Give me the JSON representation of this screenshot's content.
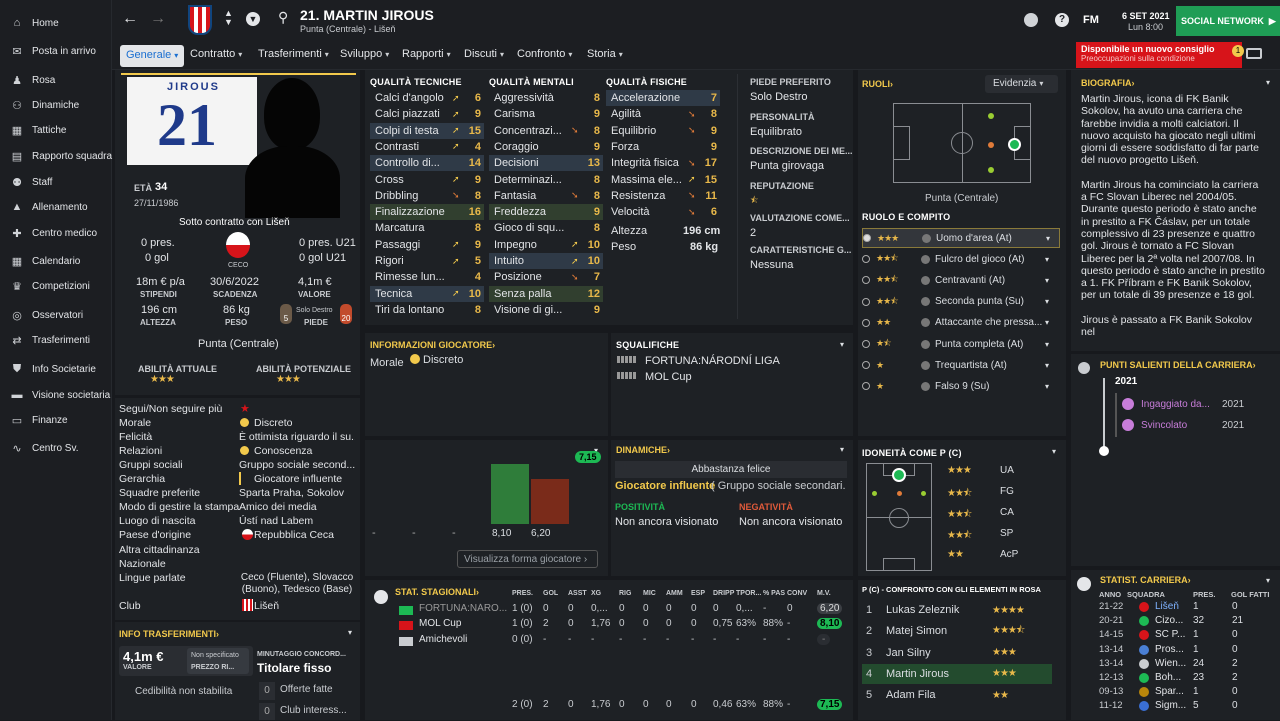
{
  "sidebar": {
    "items": [
      {
        "label": "Home",
        "icon": "home-icon",
        "glyph": "⌂"
      },
      {
        "label": "Posta in arrivo",
        "icon": "inbox-icon",
        "glyph": "✉"
      },
      {
        "label": "Rosa",
        "icon": "squad-icon",
        "glyph": "♟"
      },
      {
        "label": "Dinamiche",
        "icon": "dynamics-icon",
        "glyph": "⚇"
      },
      {
        "label": "Tattiche",
        "icon": "tactics-icon",
        "glyph": "▦"
      },
      {
        "label": "Rapporto squadra",
        "icon": "report-icon",
        "glyph": "▤"
      },
      {
        "label": "Staff",
        "icon": "staff-icon",
        "glyph": "⚉"
      },
      {
        "label": "Allenamento",
        "icon": "training-icon",
        "glyph": "▲"
      },
      {
        "label": "Centro medico",
        "icon": "medical-icon",
        "glyph": "✚"
      },
      {
        "label": "Calendario",
        "icon": "calendar-icon",
        "glyph": "▦"
      },
      {
        "label": "Competizioni",
        "icon": "trophy-icon",
        "glyph": "♛"
      },
      {
        "label": "Osservatori",
        "icon": "scout-icon",
        "glyph": "◎"
      },
      {
        "label": "Trasferimenti",
        "icon": "transfer-icon",
        "glyph": "⇄"
      },
      {
        "label": "Info Societarie",
        "icon": "club-info-icon",
        "glyph": "⛊"
      },
      {
        "label": "Visione societaria",
        "icon": "vision-icon",
        "glyph": "▬"
      },
      {
        "label": "Finanze",
        "icon": "finance-icon",
        "glyph": "▭"
      },
      {
        "label": "Centro Sv.",
        "icon": "dev-centre-icon",
        "glyph": "∿"
      }
    ]
  },
  "header": {
    "title": "21. MARTIN JIROUS",
    "subtitle": "Punta (Centrale) - Lišeň",
    "date": "6 SET 2021",
    "time": "Lun 8:00",
    "social": "SOCIAL NETWORK",
    "fm": "FM",
    "help": "?"
  },
  "tabs": [
    "Generale",
    "Contratto",
    "Trasferimenti",
    "Sviluppo",
    "Rapporti",
    "Discuti",
    "Confronto",
    "Storia"
  ],
  "notice": {
    "title": "Disponibile un nuovo consiglio",
    "sub": "Preoccupazioni sulla condizione",
    "count": "1"
  },
  "profile": {
    "shirt_name": "JIROUS",
    "shirt_number": "21",
    "age_label": "ETÀ",
    "age": "34",
    "dob": "27/11/1986",
    "contract": "Sotto contratto con Lišeň",
    "apps": "0 pres.",
    "goals": "0 gol",
    "u21_apps": "0 pres. U21",
    "u21_goals": "0 gol U21",
    "nation": "CECO",
    "wage": "18m € p/a",
    "wage_label": "STIPENDI",
    "expiry": "30/6/2022",
    "expiry_label": "SCADENZA",
    "value": "4,1m €",
    "value_label": "VALORE",
    "height": "196 cm",
    "height_label": "ALTEZZA",
    "weight": "86 kg",
    "weight_label": "PESO",
    "foot_left": "5",
    "foot_right": "20",
    "foot_text": "Solo Destro",
    "foot_label": "PIEDE",
    "position": "Punta (Centrale)",
    "ca_label": "ABILITÀ ATTUALE",
    "pa_label": "ABILITÀ POTENZIALE"
  },
  "details": [
    {
      "k": "Segui/Non seguire più",
      "v": ""
    },
    {
      "k": "Morale",
      "v": "Discreto"
    },
    {
      "k": "Felicità",
      "v": "È ottimista riguardo il su..."
    },
    {
      "k": "Relazioni",
      "v": "Conoscenza"
    },
    {
      "k": "Gruppi sociali",
      "v": "Gruppo sociale second..."
    },
    {
      "k": "Gerarchia",
      "v": "Giocatore influente"
    },
    {
      "k": "Squadre preferite",
      "v": "Sparta Praha, Sokolov"
    },
    {
      "k": "Modo di gestire la stampa",
      "v": "Amico dei media"
    },
    {
      "k": "Luogo di nascita",
      "v": "Ústí nad Labem"
    },
    {
      "k": "Paese d'origine",
      "v": "Repubblica Ceca"
    },
    {
      "k": "Altra cittadinanza",
      "v": ""
    },
    {
      "k": "Nazionale",
      "v": ""
    },
    {
      "k": "Lingue parlate",
      "v": "Ceco (Fluente), Slovacco (Buono), Tedesco (Base)"
    },
    {
      "k": "Club",
      "v": "Lišeň"
    }
  ],
  "transfer": {
    "title": "INFO TRASFERIMENTI",
    "value": "4,1m €",
    "value_label": "VALORE",
    "asking": "Non specificato",
    "asking_label": "PREZZO RI...",
    "status": "Cedibilità non stabilita",
    "playing_time_label": "MINUTAGGIO CONCORD...",
    "playing_time": "Titolare fisso",
    "offers": "Offerte fatte",
    "offers_n": "0",
    "interest": "Club interess...",
    "interest_n": "0"
  },
  "attributes": {
    "technical_title": "QUALITÀ TECNICHE",
    "mental_title": "QUALITÀ MENTALI",
    "physical_title": "QUALITÀ FISICHE",
    "technical": [
      {
        "n": "Calci d'angolo",
        "v": "6",
        "a": "up",
        "h": ""
      },
      {
        "n": "Calci piazzati",
        "v": "9",
        "a": "up",
        "h": ""
      },
      {
        "n": "Colpi di testa",
        "v": "15",
        "a": "up",
        "h": "b"
      },
      {
        "n": "Contrasti",
        "v": "4",
        "a": "up",
        "h": ""
      },
      {
        "n": "Controllo di...",
        "v": "14",
        "a": "",
        "h": "b"
      },
      {
        "n": "Cross",
        "v": "9",
        "a": "up",
        "h": ""
      },
      {
        "n": "Dribbling",
        "v": "8",
        "a": "down",
        "h": ""
      },
      {
        "n": "Finalizzazione",
        "v": "16",
        "a": "",
        "h": "g"
      },
      {
        "n": "Marcatura",
        "v": "8",
        "a": "",
        "h": ""
      },
      {
        "n": "Passaggi",
        "v": "9",
        "a": "up",
        "h": ""
      },
      {
        "n": "Rigori",
        "v": "5",
        "a": "up",
        "h": ""
      },
      {
        "n": "Rimesse lun...",
        "v": "4",
        "a": "",
        "h": ""
      },
      {
        "n": "Tecnica",
        "v": "10",
        "a": "up",
        "h": "b"
      },
      {
        "n": "Tiri da lontano",
        "v": "8",
        "a": "",
        "h": ""
      }
    ],
    "mental": [
      {
        "n": "Aggressività",
        "v": "8",
        "a": "",
        "h": ""
      },
      {
        "n": "Carisma",
        "v": "9",
        "a": "",
        "h": ""
      },
      {
        "n": "Concentrazi...",
        "v": "8",
        "a": "down",
        "h": ""
      },
      {
        "n": "Coraggio",
        "v": "9",
        "a": "",
        "h": ""
      },
      {
        "n": "Decisioni",
        "v": "13",
        "a": "",
        "h": "b"
      },
      {
        "n": "Determinazi...",
        "v": "8",
        "a": "",
        "h": ""
      },
      {
        "n": "Fantasia",
        "v": "8",
        "a": "down",
        "h": ""
      },
      {
        "n": "Freddezza",
        "v": "9",
        "a": "",
        "h": "g"
      },
      {
        "n": "Gioco di squ...",
        "v": "8",
        "a": "",
        "h": ""
      },
      {
        "n": "Impegno",
        "v": "10",
        "a": "up",
        "h": ""
      },
      {
        "n": "Intuito",
        "v": "10",
        "a": "up",
        "h": "b"
      },
      {
        "n": "Posizione",
        "v": "7",
        "a": "down",
        "h": ""
      },
      {
        "n": "Senza palla",
        "v": "12",
        "a": "",
        "h": "g"
      },
      {
        "n": "Visione di gi...",
        "v": "9",
        "a": "",
        "h": ""
      }
    ],
    "physical": [
      {
        "n": "Accelerazione",
        "v": "7",
        "a": "",
        "h": "b"
      },
      {
        "n": "Agilità",
        "v": "8",
        "a": "down",
        "h": ""
      },
      {
        "n": "Equilibrio",
        "v": "9",
        "a": "down",
        "h": ""
      },
      {
        "n": "Forza",
        "v": "9",
        "a": "",
        "h": ""
      },
      {
        "n": "Integrità fisica",
        "v": "17",
        "a": "down",
        "h": ""
      },
      {
        "n": "Massima ele...",
        "v": "15",
        "a": "up",
        "h": ""
      },
      {
        "n": "Resistenza",
        "v": "11",
        "a": "down",
        "h": ""
      },
      {
        "n": "Velocità",
        "v": "6",
        "a": "down",
        "h": ""
      }
    ],
    "height_label": "Altezza",
    "height": "196 cm",
    "weight_label": "Peso",
    "weight": "86 kg"
  },
  "side_info": [
    {
      "k": "PIEDE PREFERITO",
      "v": "Solo Destro"
    },
    {
      "k": "PERSONALITÀ",
      "v": "Equilibrato"
    },
    {
      "k": "DESCRIZIONE DEI ME...",
      "v": "Punta girovaga"
    },
    {
      "k": "REPUTAZIONE",
      "v": ""
    },
    {
      "k": "VALUTAZIONE COME...",
      "v": "2"
    },
    {
      "k": "CARATTERISTICHE G...",
      "v": "Nessuna"
    }
  ],
  "roles": {
    "title": "RUOLI",
    "evidence": "Evidenzia",
    "position": "Punta (Centrale)",
    "role_title": "RUOLO E COMPITO",
    "list": [
      {
        "n": "Uomo d'area (At)",
        "s": "3"
      },
      {
        "n": "Fulcro del gioco (At)",
        "s": "2.5"
      },
      {
        "n": "Centravanti (At)",
        "s": "2.5"
      },
      {
        "n": "Seconda punta (Su)",
        "s": "2.5"
      },
      {
        "n": "Attaccante che pressa...",
        "s": "2"
      },
      {
        "n": "Punta completa (At)",
        "s": "1.5"
      },
      {
        "n": "Trequartista (At)",
        "s": "1"
      },
      {
        "n": "Falso 9 (Su)",
        "s": "1"
      }
    ]
  },
  "player_info": {
    "title": "INFORMAZIONI GIOCATORE",
    "morale_label": "Morale",
    "morale": "Discreto"
  },
  "suspensions": {
    "title": "SQUALIFICHE",
    "items": [
      "FORTUNA:NÁRODNÍ LIGA",
      "MOL Cup"
    ]
  },
  "form": {
    "badge": "7,15",
    "bars": [
      {
        "label": "8,10"
      },
      {
        "label": "6,20"
      }
    ],
    "empty": [
      "-",
      "-",
      "-"
    ],
    "link": "Visualizza forma giocatore"
  },
  "dynamics": {
    "title": "DINAMICHE",
    "happiness": "Abbastanza felice",
    "status": "Giocatore influente",
    "group": "( Gruppo sociale secondari...",
    "pos_label": "POSITIVITÀ",
    "pos": "Non ancora visionato",
    "neg_label": "NEGATIVITÀ",
    "neg": "Non ancora visionato"
  },
  "suitability": {
    "title": "IDONEITÀ COME P (C)",
    "rows": [
      {
        "p": "UA",
        "s": "3"
      },
      {
        "p": "FG",
        "s": "2.5"
      },
      {
        "p": "CA",
        "s": "2.5"
      },
      {
        "p": "SP",
        "s": "2.5"
      },
      {
        "p": "AcP",
        "s": "2"
      }
    ]
  },
  "season_stats": {
    "title": "STAT. STAGIONALI",
    "cols": [
      "PRES.",
      "GOL",
      "ASST",
      "XG",
      "RIG",
      "MIC",
      "AMM",
      "ESP",
      "DRIPP",
      "TPOR...",
      "% PAS",
      "CONV",
      "M.V."
    ],
    "rows": [
      {
        "c": "FORTUNA:NÁRO...",
        "v": [
          "1 (0)",
          "0",
          "0",
          "0,...",
          "0",
          "0",
          "0",
          "0",
          "0",
          "0,...",
          "-",
          "0",
          "6,20"
        ]
      },
      {
        "c": "MOL Cup",
        "v": [
          "1 (0)",
          "2",
          "0",
          "1,76",
          "0",
          "0",
          "0",
          "0",
          "0,75",
          "63%",
          "88%",
          "-",
          "8,10"
        ]
      },
      {
        "c": "Amichevoli",
        "v": [
          "0 (0)",
          "-",
          "-",
          "-",
          "-",
          "-",
          "-",
          "-",
          "-",
          "-",
          "-",
          "-",
          "-"
        ]
      }
    ],
    "total": [
      "2 (0)",
      "2",
      "0",
      "1,76",
      "0",
      "0",
      "0",
      "0",
      "0,46",
      "63%",
      "88%",
      "-",
      "7,15"
    ]
  },
  "comparison": {
    "title": "P (C) - CONFRONTO CON GLI ELEMENTI IN ROSA",
    "rows": [
      {
        "n": "1",
        "nm": "Lukas Zeleznik",
        "s": "4"
      },
      {
        "n": "2",
        "nm": "Matej Simon",
        "s": "3.5"
      },
      {
        "n": "3",
        "nm": "Jan Silny",
        "s": "3"
      },
      {
        "n": "4",
        "nm": "Martin Jirous",
        "s": "3"
      },
      {
        "n": "5",
        "nm": "Adam Fila",
        "s": "2"
      }
    ]
  },
  "bio": {
    "title": "BIOGRAFIA",
    "p1": "Martin Jirous, icona di FK Banik Sokolov, ha avuto una carriera che farebbe invidia a molti calciatori. Il nuovo acquisto ha giocato negli ultimi giorni di essere soddisfatto di far parte del nuovo progetto Lišeň.",
    "p2": "Martin Jirous ha cominciato la carriera a FC Slovan Liberec nel 2004/05. Durante questo periodo è stato anche in prestito a FK Čáslav, per un totale complessivo di 23 presenze e quattro gol. Jirous è tornato a FC Slovan Liberec per la 2ª volta nel 2007/08. In questo periodo è stato anche in prestito a 1. FK Příbram e FK Banik Sokolov, per un totale di 39 presenze e 18 gol.",
    "p3": "Jirous è passato a FK Banik Sokolov nel"
  },
  "highlights": {
    "title": "PUNTI SALIENTI DELLA CARRIERA",
    "year": "2021",
    "items": [
      {
        "t": "Ingaggiato da...",
        "y": "2021"
      },
      {
        "t": "Svincolato",
        "y": "2021"
      }
    ]
  },
  "career": {
    "title": "STATIST. CARRIERA",
    "cols": [
      "ANNO",
      "SQUADRA",
      "PRES.",
      "GOL FATTI"
    ],
    "rows": [
      {
        "y": "21-22",
        "t": "Lišeň",
        "a": "1",
        "g": "0"
      },
      {
        "y": "20-21",
        "t": "Cizo...",
        "a": "32",
        "g": "21"
      },
      {
        "y": "14-15",
        "t": "SC P...",
        "a": "1",
        "g": "0"
      },
      {
        "y": "13-14",
        "t": "Pros...",
        "a": "1",
        "g": "0"
      },
      {
        "y": "13-14",
        "t": "Wien...",
        "a": "24",
        "g": "2"
      },
      {
        "y": "12-13",
        "t": "Boh...",
        "a": "23",
        "g": "2"
      },
      {
        "y": "09-13",
        "t": "Spar...",
        "a": "1",
        "g": "0"
      },
      {
        "y": "11-12",
        "t": "Sigm...",
        "a": "5",
        "g": "0"
      }
    ]
  },
  "colors": {
    "accent": "#f2c94c",
    "green": "#1db954",
    "red": "#d7141a",
    "highlight": "#2f3a47"
  }
}
